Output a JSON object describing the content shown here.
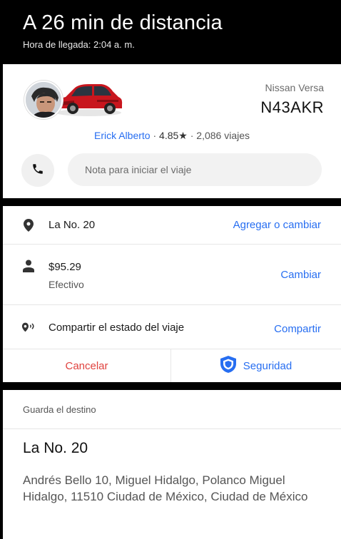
{
  "header": {
    "title": "A 26 min de distancia",
    "arrival": "Hora de llegada: 2:04 a. m."
  },
  "driver": {
    "vehicle_model": "Nissan Versa",
    "plate": "N43AKR",
    "name": "Erick Alberto",
    "rating": "4.85★",
    "trips": "2,086 viajes",
    "separator": "·"
  },
  "note": {
    "placeholder": "Nota para iniciar el viaje"
  },
  "trip": {
    "destination": "La No. 20",
    "destination_action": "Agregar o cambiar",
    "price": "$95.29",
    "payment_method": "Efectivo",
    "payment_action": "Cambiar",
    "share_label": "Compartir el estado del viaje",
    "share_action": "Compartir",
    "cancel": "Cancelar",
    "safety": "Seguridad"
  },
  "saved_destination": {
    "header": "Guarda el destino",
    "name": "La No. 20",
    "address": "Andrés Bello 10, Miguel Hidalgo, Polanco Miguel Hidalgo, 11510 Ciudad de México, Ciudad de México"
  },
  "colors": {
    "accent_blue": "#276ef1",
    "cancel_red": "#e0423e",
    "car_red": "#c8161e"
  },
  "icons": [
    "phone-icon",
    "location-pin-icon",
    "person-icon",
    "share-status-icon",
    "shield-icon"
  ]
}
